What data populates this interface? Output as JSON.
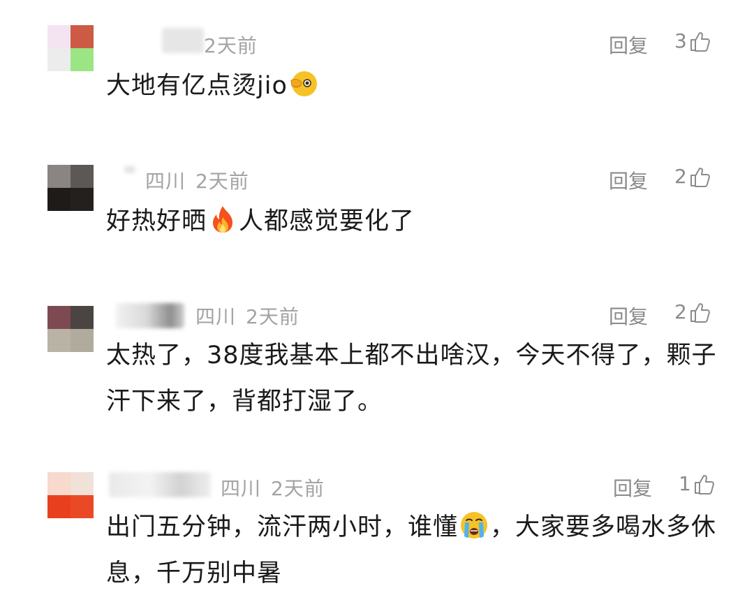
{
  "comments": [
    {
      "location": "",
      "time": "2天前",
      "reply_label": "回复",
      "likes": "3",
      "content_before": "大地有亿点烫jio",
      "emoji": "hand-over-eye-emoji",
      "content_after": "",
      "avatar_colors": [
        "#f4e4f2",
        "#cc5a44",
        "#ececec",
        "#9be585"
      ]
    },
    {
      "location": "四川",
      "time": "2天前",
      "reply_label": "回复",
      "likes": "2",
      "content_before": "好热好晒",
      "emoji": "fire-emoji",
      "content_after": "人都感觉要化了",
      "avatar_colors": [
        "#8a8483",
        "#5c5855",
        "#1e1b19",
        "#24201d"
      ]
    },
    {
      "location": "四川",
      "time": "2天前",
      "reply_label": "回复",
      "likes": "2",
      "content_before": "太热了，38度我基本上都不出啥汉，今天不得了，颗子汗下来了，背都打湿了。",
      "emoji": "",
      "content_after": "",
      "avatar_colors": [
        "#7e4a52",
        "#4a4443",
        "#b8b3a5",
        "#b0ab9c"
      ]
    },
    {
      "location": "四川",
      "time": "2天前",
      "reply_label": "回复",
      "likes": "1",
      "content_before": "出门五分钟，流汗两小时，谁懂",
      "emoji": "crying-face-emoji",
      "content_after": "，大家要多喝水多休息，千万别中暑",
      "avatar_colors": [
        "#f7d9cd",
        "#f0e2d8",
        "#e8401f",
        "#e94a25"
      ]
    }
  ]
}
